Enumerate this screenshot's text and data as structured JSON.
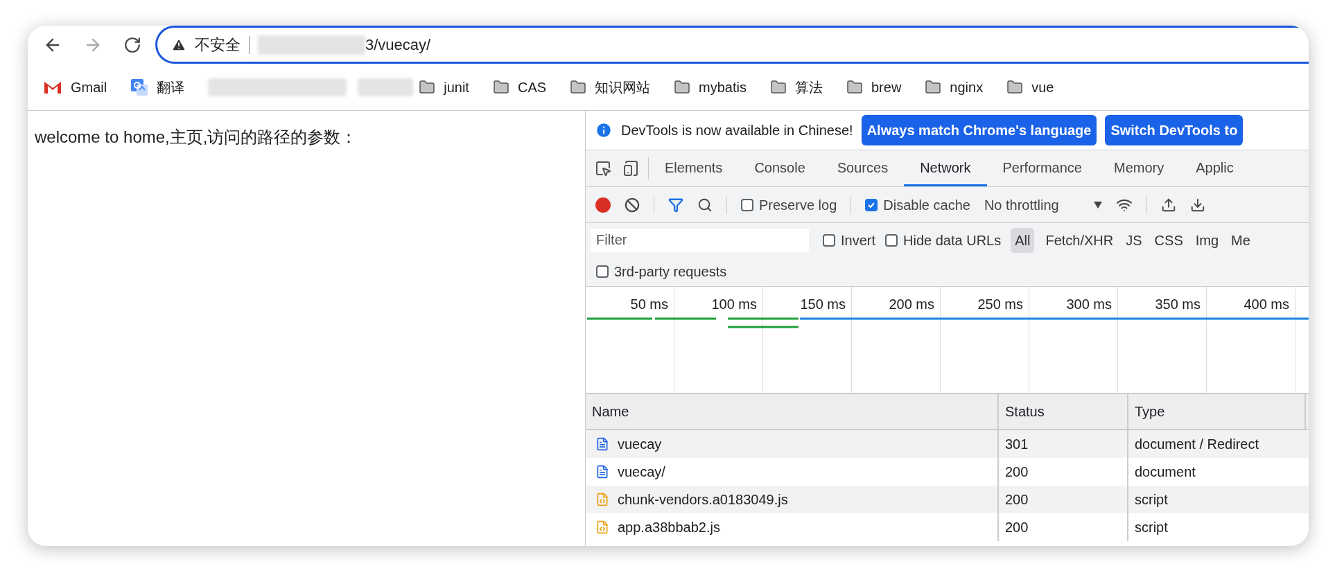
{
  "browser": {
    "address": {
      "warning": "不安全",
      "url_visible": "3/vuecay/"
    },
    "bookmarks": [
      {
        "kind": "gmail",
        "label": "Gmail"
      },
      {
        "kind": "translate",
        "label": "翻译"
      },
      {
        "kind": "blurred"
      },
      {
        "kind": "folder",
        "label": "junit"
      },
      {
        "kind": "folder",
        "label": "CAS"
      },
      {
        "kind": "folder",
        "label": "知识网站"
      },
      {
        "kind": "folder",
        "label": "mybatis"
      },
      {
        "kind": "folder",
        "label": "算法"
      },
      {
        "kind": "folder",
        "label": "brew"
      },
      {
        "kind": "folder",
        "label": "nginx"
      },
      {
        "kind": "folder",
        "label": "vue"
      }
    ]
  },
  "page": {
    "text": "welcome to home,主页,访问的路径的参数："
  },
  "devtools": {
    "banner": {
      "message": "DevTools is now available in Chinese!",
      "buttons": [
        "Always match Chrome's language",
        "Switch DevTools to"
      ]
    },
    "tabs": [
      {
        "label": "Elements",
        "selected": false
      },
      {
        "label": "Console",
        "selected": false
      },
      {
        "label": "Sources",
        "selected": false
      },
      {
        "label": "Network",
        "selected": true
      },
      {
        "label": "Performance",
        "selected": false
      },
      {
        "label": "Memory",
        "selected": false
      },
      {
        "label": "Applic",
        "selected": false
      }
    ],
    "toolbar": {
      "recording": true,
      "preserve_log": {
        "label": "Preserve log",
        "checked": false
      },
      "disable_cache": {
        "label": "Disable cache",
        "checked": true
      },
      "throttling": "No throttling"
    },
    "filter": {
      "placeholder": "Filter",
      "invert": {
        "label": "Invert",
        "checked": false
      },
      "hide_data_urls": {
        "label": "Hide data URLs",
        "checked": false
      },
      "types": [
        {
          "label": "All",
          "selected": true
        },
        {
          "label": "Fetch/XHR",
          "selected": false
        },
        {
          "label": "JS",
          "selected": false
        },
        {
          "label": "CSS",
          "selected": false
        },
        {
          "label": "Img",
          "selected": false
        },
        {
          "label": "Me",
          "selected": false
        }
      ],
      "third_party": {
        "label": "3rd-party requests",
        "checked": false
      }
    },
    "timeline": {
      "ticks": [
        "50 ms",
        "100 ms",
        "150 ms",
        "200 ms",
        "250 ms",
        "300 ms",
        "350 ms",
        "400 ms"
      ]
    },
    "table": {
      "columns": [
        "Name",
        "Status",
        "Type"
      ],
      "rows": [
        {
          "kind": "document",
          "name": "vuecay",
          "status": "301",
          "type": "document / Redirect"
        },
        {
          "kind": "document",
          "name": "vuecay/",
          "status": "200",
          "type": "document"
        },
        {
          "kind": "script",
          "name": "chunk-vendors.a0183049.js",
          "status": "200",
          "type": "script"
        },
        {
          "kind": "script",
          "name": "app.a38bbab2.js",
          "status": "200",
          "type": "script"
        }
      ]
    }
  }
}
